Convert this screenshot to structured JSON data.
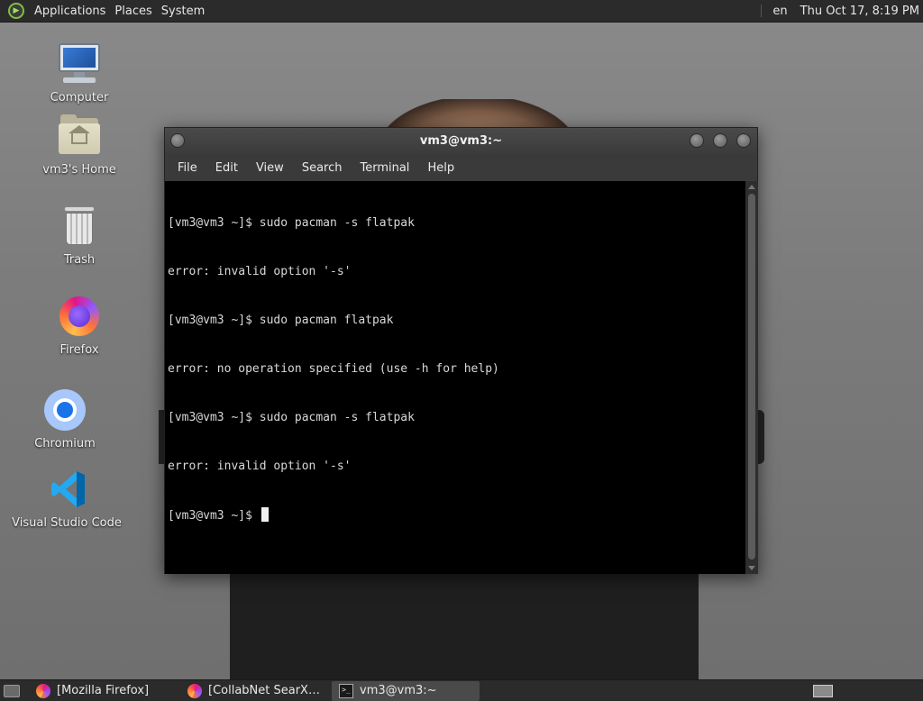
{
  "top_panel": {
    "menus": [
      "Applications",
      "Places",
      "System"
    ],
    "language": "en",
    "clock": "Thu Oct 17,  8:19 PM"
  },
  "desktop_icons": [
    {
      "label": "Computer",
      "icon": "computer-icon"
    },
    {
      "label": "vm3's Home",
      "icon": "home-folder-icon"
    },
    {
      "label": "Trash",
      "icon": "trash-icon"
    },
    {
      "label": "Firefox",
      "icon": "firefox-icon"
    },
    {
      "label": "Chromium",
      "icon": "chromium-icon"
    },
    {
      "label": "Visual Studio Code",
      "icon": "vscode-icon"
    }
  ],
  "terminal": {
    "title": "vm3@vm3:~",
    "menu": [
      "File",
      "Edit",
      "View",
      "Search",
      "Terminal",
      "Help"
    ],
    "lines": [
      "[vm3@vm3 ~]$ sudo pacman -s flatpak",
      "error: invalid option '-s'",
      "[vm3@vm3 ~]$ sudo pacman flatpak",
      "error: no operation specified (use -h for help)",
      "[vm3@vm3 ~]$ sudo pacman -s flatpak",
      "error: invalid option '-s'"
    ],
    "prompt": "[vm3@vm3 ~]$ "
  },
  "taskbar": {
    "tasks": [
      {
        "label": "[Mozilla Firefox]",
        "icon": "firefox-icon",
        "active": false
      },
      {
        "label": "[CollabNet SearXN...",
        "icon": "firefox-icon",
        "active": false
      },
      {
        "label": "vm3@vm3:~",
        "icon": "terminal-icon",
        "active": true
      }
    ]
  },
  "colors": {
    "panel_bg": "#2b2b2b",
    "terminal_bg": "#000000",
    "terminal_fg": "#d8d8d8",
    "accent_green": "#7fbf3f"
  }
}
